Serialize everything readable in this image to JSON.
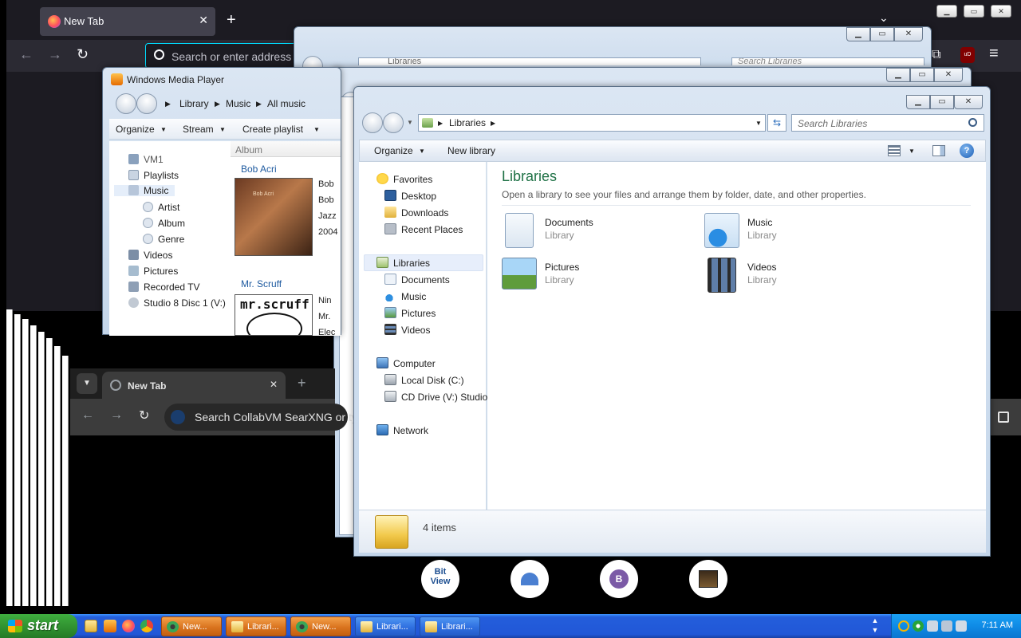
{
  "firefox": {
    "tab_title": "New Tab",
    "tab_close": "✕",
    "new_tab": "+",
    "list_tabs": "⌄",
    "url_placeholder": "Search or enter address",
    "back": "←",
    "forward": "→",
    "reload": "↻",
    "extensions": "⧉",
    "ublock": "uD",
    "menu": "≡"
  },
  "wmp": {
    "title": "Windows Media Player",
    "breadcrumb": [
      "Library",
      "Music",
      "All music"
    ],
    "toolbar": [
      "Organize",
      "Stream",
      "Create playlist"
    ],
    "column_header": "Album",
    "tree": [
      "VM1",
      "Playlists",
      "Music",
      "Artist",
      "Album",
      "Genre",
      "Videos",
      "Pictures",
      "Recorded TV",
      "Studio 8 Disc 1 (V:)"
    ],
    "albums": [
      {
        "artist": "Bob Acri",
        "cover_text": "Bob Acri",
        "meta": [
          "Bob",
          "Bob",
          "Jazz",
          "2004"
        ]
      },
      {
        "artist": "Mr. Scruff",
        "cover_text": "mr.scruff",
        "meta": [
          "Nin",
          "Mr.",
          "Elec"
        ]
      }
    ]
  },
  "explorer": {
    "address": "Libraries",
    "search_placeholder": "Search Libraries",
    "toolbar": {
      "organize": "Organize",
      "new_library": "New library"
    },
    "nav": {
      "favorites": "Favorites",
      "favorite_items": [
        "Desktop",
        "Downloads",
        "Recent Places"
      ],
      "libraries": "Libraries",
      "library_items": [
        "Documents",
        "Music",
        "Pictures",
        "Videos"
      ],
      "computer": "Computer",
      "drives": [
        "Local Disk (C:)",
        "CD Drive (V:) Studio"
      ],
      "network": "Network"
    },
    "heading": "Libraries",
    "subheading": "Open a library to see your files and arrange them by folder, date, and other properties.",
    "libraries": [
      {
        "name": "Documents",
        "type": "Library"
      },
      {
        "name": "Music",
        "type": "Library"
      },
      {
        "name": "Pictures",
        "type": "Library"
      },
      {
        "name": "Videos",
        "type": "Library"
      }
    ],
    "item_count": "4 items",
    "back_window_search": "Search Libraries",
    "back_window_address": "Libraries"
  },
  "chrome": {
    "tab_title": "New Tab",
    "tab_close": "✕",
    "new_tab": "+",
    "omnibox": "Search CollabVM SearXNG or type a URL"
  },
  "shortcuts": [
    {
      "name": "BitView",
      "glyph": "Bit\nView"
    },
    {
      "name": "site-2",
      "glyph": ""
    },
    {
      "name": "site-3",
      "glyph": "B"
    },
    {
      "name": "site-4",
      "glyph": ""
    }
  ],
  "taskbar": {
    "start": "start",
    "buttons": [
      "New...",
      "Librari...",
      "New...",
      "Librari...",
      "Librari..."
    ],
    "clock": "7:11 AM"
  },
  "colors": {
    "xp_blue": "#245edb",
    "start_green": "#2f8f2f",
    "explorer_heading": "#1e7145",
    "firefox_bg": "#1c1b22"
  }
}
